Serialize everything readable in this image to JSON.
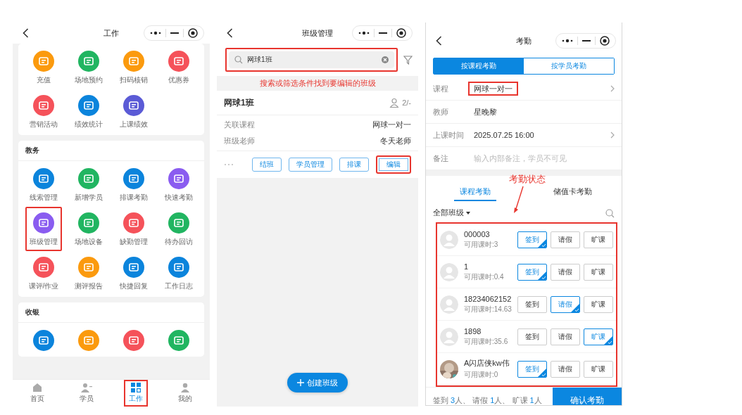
{
  "work_screen": {
    "title": "工作",
    "sections": [
      {
        "items": [
          {
            "label": "充值",
            "color": "#fb9a0e",
            "highlighted": false
          },
          {
            "label": "场地预约",
            "color": "#21b561",
            "highlighted": false
          },
          {
            "label": "扫码核销",
            "color": "#fb9a0e",
            "highlighted": false
          },
          {
            "label": "优惠券",
            "color": "#f5525a",
            "highlighted": false
          },
          {
            "label": "营销活动",
            "color": "#f5525a",
            "highlighted": false
          },
          {
            "label": "绩效统计",
            "color": "#0b84dc",
            "highlighted": false
          },
          {
            "label": "上课绩效",
            "color": "#5b5bd6",
            "highlighted": false
          }
        ]
      },
      {
        "title": "教务",
        "items": [
          {
            "label": "线索管理",
            "color": "#0b84dc",
            "highlighted": false
          },
          {
            "label": "新增学员",
            "color": "#21b561",
            "highlighted": false
          },
          {
            "label": "排课考勤",
            "color": "#0b84dc",
            "highlighted": false
          },
          {
            "label": "快速考勤",
            "color": "#8a5cf0",
            "highlighted": false
          },
          {
            "label": "班级管理",
            "color": "#8a5cf0",
            "highlighted": true
          },
          {
            "label": "场地设备",
            "color": "#21b561",
            "highlighted": false
          },
          {
            "label": "缺勤管理",
            "color": "#f5525a",
            "highlighted": false
          },
          {
            "label": "待办回访",
            "color": "#21b561",
            "highlighted": false
          },
          {
            "label": "课评/作业",
            "color": "#f5525a",
            "highlighted": false
          },
          {
            "label": "测评报告",
            "color": "#fb9a0e",
            "highlighted": false
          },
          {
            "label": "快捷回复",
            "color": "#0b84dc",
            "highlighted": false
          },
          {
            "label": "工作日志",
            "color": "#0b84dc",
            "highlighted": false
          }
        ]
      },
      {
        "title": "收银",
        "items": [
          {
            "color": "#0b84dc",
            "highlighted": false
          },
          {
            "color": "#fb9a0e",
            "highlighted": false
          },
          {
            "color": "#f5525a",
            "highlighted": false
          },
          {
            "color": "#21b561",
            "highlighted": false
          }
        ]
      }
    ],
    "tab_bar": [
      {
        "label": "首页",
        "selected": false,
        "highlighted": false
      },
      {
        "label": "学员",
        "selected": false,
        "highlighted": false
      },
      {
        "label": "工作",
        "selected": true,
        "highlighted": true
      },
      {
        "label": "我的",
        "selected": false,
        "highlighted": false
      }
    ]
  },
  "class_screen": {
    "title": "班级管理",
    "search": {
      "value": "网球1班",
      "highlighted": true
    },
    "annotation": "搜索或筛选条件找到要编辑的班级",
    "class_card": {
      "name": "网球1班",
      "count": "2/-",
      "fields": [
        {
          "label": "关联课程",
          "value": "网球一对一"
        },
        {
          "label": "班级老师",
          "value": "冬天老师"
        }
      ],
      "actions": [
        {
          "label": "结班",
          "highlighted": false
        },
        {
          "label": "学员管理",
          "highlighted": false
        },
        {
          "label": "排课",
          "highlighted": false
        },
        {
          "label": "编辑",
          "highlighted": true
        }
      ]
    },
    "create_button": "创建班级"
  },
  "attendance_screen": {
    "title": "考勤",
    "mode_tabs": [
      {
        "label": "按课程考勤",
        "selected": true
      },
      {
        "label": "按学员考勤",
        "selected": false
      }
    ],
    "form": [
      {
        "label": "课程",
        "value": "网球一对一",
        "chevron": true,
        "highlighted": true
      },
      {
        "label": "教师",
        "value": "星晚黎",
        "chevron": false,
        "highlighted": false
      },
      {
        "label": "上课时间",
        "value": "2025.07.25 16:00",
        "chevron": true,
        "highlighted": false
      },
      {
        "label": "备注",
        "placeholder": "输入内部备注，学员不可见",
        "chevron": false,
        "highlighted": false
      }
    ],
    "annotation": "考勤状态",
    "tabs": [
      {
        "label": "课程考勤",
        "selected": true
      },
      {
        "label": "储值卡考勤",
        "selected": false
      }
    ],
    "filter": "全部班级",
    "list_highlighted": true,
    "students": [
      {
        "name": "000003",
        "hours": "可用课时:3",
        "kind": "default",
        "options": [
          {
            "label": "签到",
            "selected": true
          },
          {
            "label": "请假",
            "selected": false
          },
          {
            "label": "旷课",
            "selected": false
          }
        ]
      },
      {
        "name": "1",
        "hours": "可用课时:0.4",
        "kind": "default",
        "options": [
          {
            "label": "签到",
            "selected": true
          },
          {
            "label": "请假",
            "selected": false
          },
          {
            "label": "旷课",
            "selected": false
          }
        ]
      },
      {
        "name": "18234062152",
        "hours": "可用课时:14.63",
        "kind": "default",
        "options": [
          {
            "label": "签到",
            "selected": false
          },
          {
            "label": "请假",
            "selected": true
          },
          {
            "label": "旷课",
            "selected": false
          }
        ]
      },
      {
        "name": "1898",
        "hours": "可用课时:35.6",
        "kind": "default",
        "options": [
          {
            "label": "签到",
            "selected": false
          },
          {
            "label": "请假",
            "selected": false
          },
          {
            "label": "旷课",
            "selected": true
          }
        ]
      },
      {
        "name": "A闪店侠kw伟",
        "hours": "可用课时:0",
        "kind": "picture",
        "options": [
          {
            "label": "签到",
            "selected": true
          },
          {
            "label": "请假",
            "selected": false
          },
          {
            "label": "旷课",
            "selected": false
          }
        ]
      }
    ],
    "summary": [
      {
        "label": "签到",
        "count": "3",
        "suffix": "人、"
      },
      {
        "label": "请假",
        "count": "1",
        "suffix": "人、"
      },
      {
        "label": "旷课",
        "count": "1",
        "suffix": "人"
      }
    ],
    "confirm_button": "确认考勤"
  }
}
